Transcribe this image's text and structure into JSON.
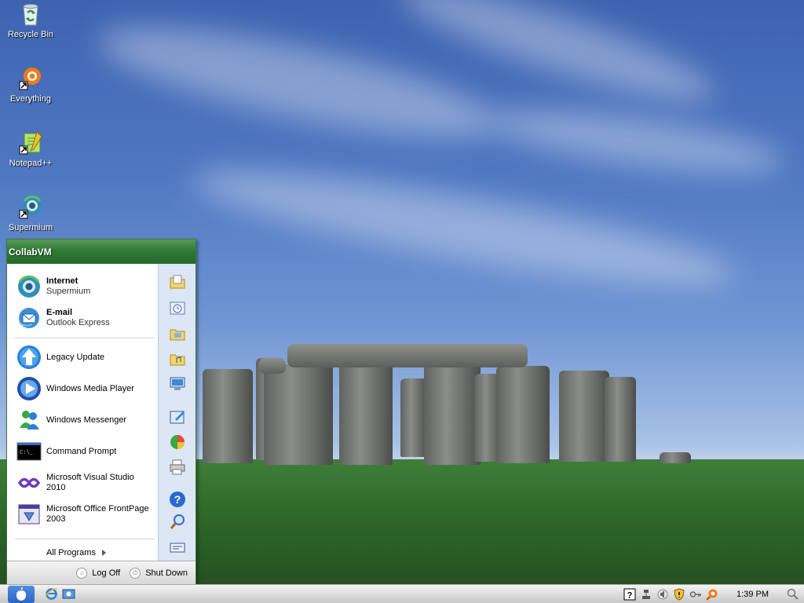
{
  "desktop": {
    "icons": [
      {
        "label": "Recycle Bin",
        "icon": "recycle-bin-icon"
      },
      {
        "label": "Everything",
        "icon": "everything-search-icon"
      },
      {
        "label": "Notepad++",
        "icon": "notepad-plus-plus-icon"
      },
      {
        "label": "Supermium",
        "icon": "supermium-browser-icon"
      }
    ]
  },
  "start_menu": {
    "user": "CollabVM",
    "pinned": [
      {
        "title": "Internet",
        "subtitle": "Supermium",
        "icon": "supermium-browser-icon"
      },
      {
        "title": "E-mail",
        "subtitle": "Outlook Express",
        "icon": "outlook-express-icon"
      }
    ],
    "recent": [
      {
        "label": "Legacy Update",
        "icon": "legacy-update-icon"
      },
      {
        "label": "Windows Media Player",
        "icon": "media-player-icon"
      },
      {
        "label": "Windows Messenger",
        "icon": "messenger-icon"
      },
      {
        "label": "Command Prompt",
        "icon": "command-prompt-icon"
      },
      {
        "line1": "Microsoft Visual Studio",
        "line2": "2010",
        "icon": "visual-studio-icon"
      },
      {
        "line1": "Microsoft Office FrontPage",
        "line2": "2003",
        "icon": "frontpage-icon"
      }
    ],
    "all_programs": "All Programs",
    "right_icons": [
      "my-documents-icon",
      "my-recent-documents-icon",
      "my-pictures-icon",
      "my-music-icon",
      "my-computer-icon",
      "control-panel-icon",
      "set-program-access-icon",
      "printers-faxes-icon",
      "help-support-icon",
      "search-icon",
      "run-icon"
    ],
    "log_off": "Log Off",
    "shut_down": "Shut Down"
  },
  "taskbar": {
    "quick_launch": [
      "internet-explorer-icon",
      "show-desktop-icon"
    ],
    "tray_icons": [
      "help-icon",
      "network-icon",
      "speaker-icon",
      "security-shield-icon",
      "key-icon",
      "everything-tray-icon"
    ],
    "clock": "1:39 PM"
  },
  "colors": {
    "start_header": "#2f7a33",
    "right_pane": "#dce6f4",
    "taskbar": "#d9d9d9"
  }
}
